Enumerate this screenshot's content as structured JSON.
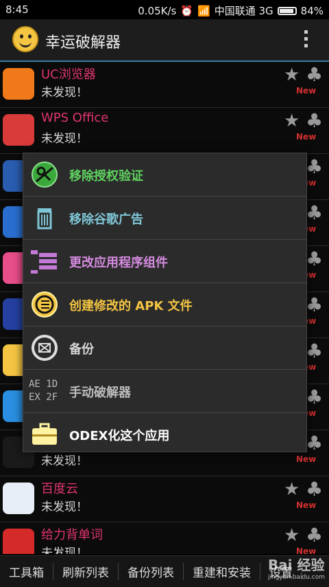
{
  "status_bar": {
    "time": "8:45",
    "speed": "0.05K/s",
    "carrier": "中国联通 3G",
    "battery": "84%"
  },
  "app": {
    "title": "幸运破解器",
    "logo_icon": "smiley-icon",
    "menu_icon": "overflow-menu-icon"
  },
  "apps": [
    {
      "name": "UC浏览器",
      "status": "未发现！",
      "badge": "New",
      "icon_color": "#f07a1a"
    },
    {
      "name": "WPS Office",
      "status": "未发现！",
      "badge": "New",
      "icon_color": "#d93a3a"
    },
    {
      "name": "",
      "status": "",
      "badge": "New",
      "icon_color": "#2a5db0"
    },
    {
      "name": "",
      "status": "",
      "badge": "New",
      "icon_color": "#2a6fd0"
    },
    {
      "name": "",
      "status": "",
      "badge": "New",
      "icon_color": "#e84e8a"
    },
    {
      "name": "",
      "status": "",
      "badge": "New",
      "icon_color": "#2540a0"
    },
    {
      "name": "",
      "status": "",
      "badge": "New",
      "icon_color": "#f4c542"
    },
    {
      "name": "",
      "status": "",
      "badge": "New",
      "icon_color": "#2a8fe0"
    },
    {
      "name": "",
      "status": "未发现！",
      "badge": "New",
      "icon_color": "#1a1a1a"
    },
    {
      "name": "百度云",
      "status": "未发现！",
      "badge": "New",
      "icon_color": "#e8eef8"
    },
    {
      "name": "给力背单词",
      "status": "未发现！",
      "badge": "New",
      "icon_color": "#d42a2a"
    }
  ],
  "menu": [
    {
      "label": "移除授权验证",
      "color": "#5fd35f",
      "icon": "remove-license-icon"
    },
    {
      "label": "移除谷歌广告",
      "color": "#7fc6d6",
      "icon": "trash-icon"
    },
    {
      "label": "更改应用程序组件",
      "color": "#d58be0",
      "icon": "components-icon"
    },
    {
      "label": "创建修改的 APK 文件",
      "color": "#f4c542",
      "icon": "build-apk-icon"
    },
    {
      "label": "备份",
      "color": "#d8d8d8",
      "icon": "backup-icon"
    },
    {
      "label": "手动破解器",
      "color": "#bdbdbd",
      "icon": "hex-icon",
      "icon_text_1": "AE 1D",
      "icon_text_2": "EX 2F"
    },
    {
      "label": "ODEX化这个应用",
      "color": "#ffffff",
      "icon": "toolbox-icon"
    }
  ],
  "bottom_bar": [
    "工具箱",
    "刷新列表",
    "备份列表",
    "重建和安装",
    "设置"
  ],
  "watermark": {
    "text": "Bai 经验",
    "sub": "jingyan.baidu.com"
  }
}
